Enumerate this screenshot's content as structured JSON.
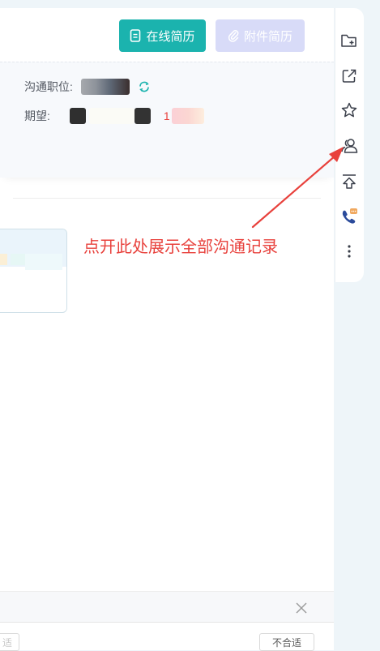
{
  "header": {
    "online_resume_label": "在线简历",
    "attachment_resume_label": "附件简历"
  },
  "candidate": {
    "position_label": "沟通职位:",
    "expectation_label": "期望:",
    "expectation_partial": "1"
  },
  "annotation": {
    "text": "点开此处展示全部沟通记录",
    "color": "#e8413c"
  },
  "footer": {
    "left_tag": "适",
    "right_tag": "不合适"
  },
  "sidebar": {
    "tools": [
      {
        "name": "add-folder-icon"
      },
      {
        "name": "external-link-icon"
      },
      {
        "name": "star-icon"
      },
      {
        "name": "contacts-icon"
      },
      {
        "name": "upload-icon"
      },
      {
        "name": "phone-icon"
      },
      {
        "name": "more-icon"
      }
    ]
  },
  "colors": {
    "accent": "#1bb3ae",
    "attachment_disabled": "#d8dbf8",
    "background": "#eef5f9"
  }
}
